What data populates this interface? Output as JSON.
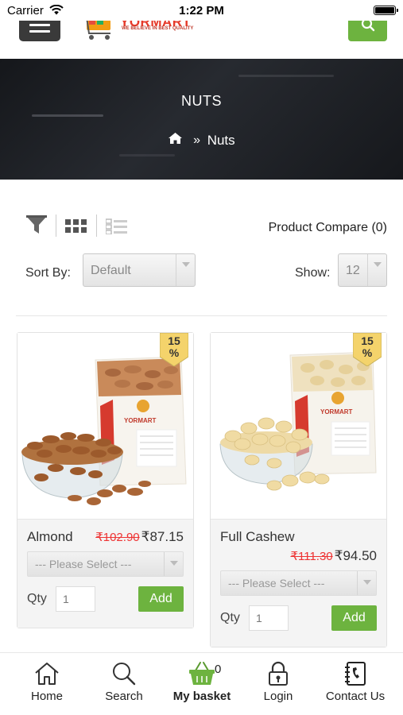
{
  "status_bar": {
    "carrier": "Carrier",
    "time": "1:22 PM"
  },
  "header": {
    "logo_text": "YORMART",
    "logo_tagline": "WE BELIEVE IN BEST QUALITY",
    "accent_color": "#6db33f"
  },
  "banner": {
    "title": "NUTS",
    "breadcrumb_separator": "»",
    "breadcrumb_current": "Nuts"
  },
  "toolbar": {
    "compare_label": "Product Compare (0)",
    "sort_label": "Sort By:",
    "sort_value": "Default",
    "show_label": "Show:",
    "show_value": "12"
  },
  "products": [
    {
      "name": "Almond",
      "old_price": "₹102.90",
      "new_price": "₹87.15",
      "discount": "15 %",
      "option_placeholder": "--- Please Select ---",
      "qty_label": "Qty",
      "qty_value": "1",
      "add_label": "Add"
    },
    {
      "name": "Full Cashew",
      "old_price": "₹111.30",
      "new_price": "₹94.50",
      "discount": "15 %",
      "option_placeholder": "--- Please Select ---",
      "qty_label": "Qty",
      "qty_value": "1",
      "add_label": "Add"
    }
  ],
  "bottom_nav": {
    "items": [
      {
        "label": "Home",
        "icon": "home-icon"
      },
      {
        "label": "Search",
        "icon": "search-icon"
      },
      {
        "label": "My basket",
        "icon": "basket-icon",
        "count": "0"
      },
      {
        "label": "Login",
        "icon": "lock-icon"
      },
      {
        "label": "Contact Us",
        "icon": "contact-book-icon"
      }
    ]
  }
}
